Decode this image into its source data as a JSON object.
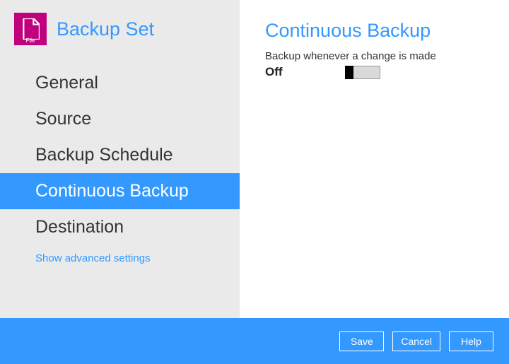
{
  "header": {
    "icon_caption": "File",
    "title": "Backup Set"
  },
  "nav": {
    "items": [
      {
        "label": "General",
        "active": false
      },
      {
        "label": "Source",
        "active": false
      },
      {
        "label": "Backup Schedule",
        "active": false
      },
      {
        "label": "Continuous Backup",
        "active": true
      },
      {
        "label": "Destination",
        "active": false
      }
    ],
    "advanced_link": "Show advanced settings"
  },
  "main": {
    "section_title": "Continuous Backup",
    "section_desc": "Backup whenever a change is made",
    "toggle_state_label": "Off"
  },
  "footer": {
    "save": "Save",
    "cancel": "Cancel",
    "help": "Help"
  },
  "colors": {
    "accent": "#3399ff",
    "brand": "#c1007d",
    "sidebar_bg": "#eaeaea"
  }
}
